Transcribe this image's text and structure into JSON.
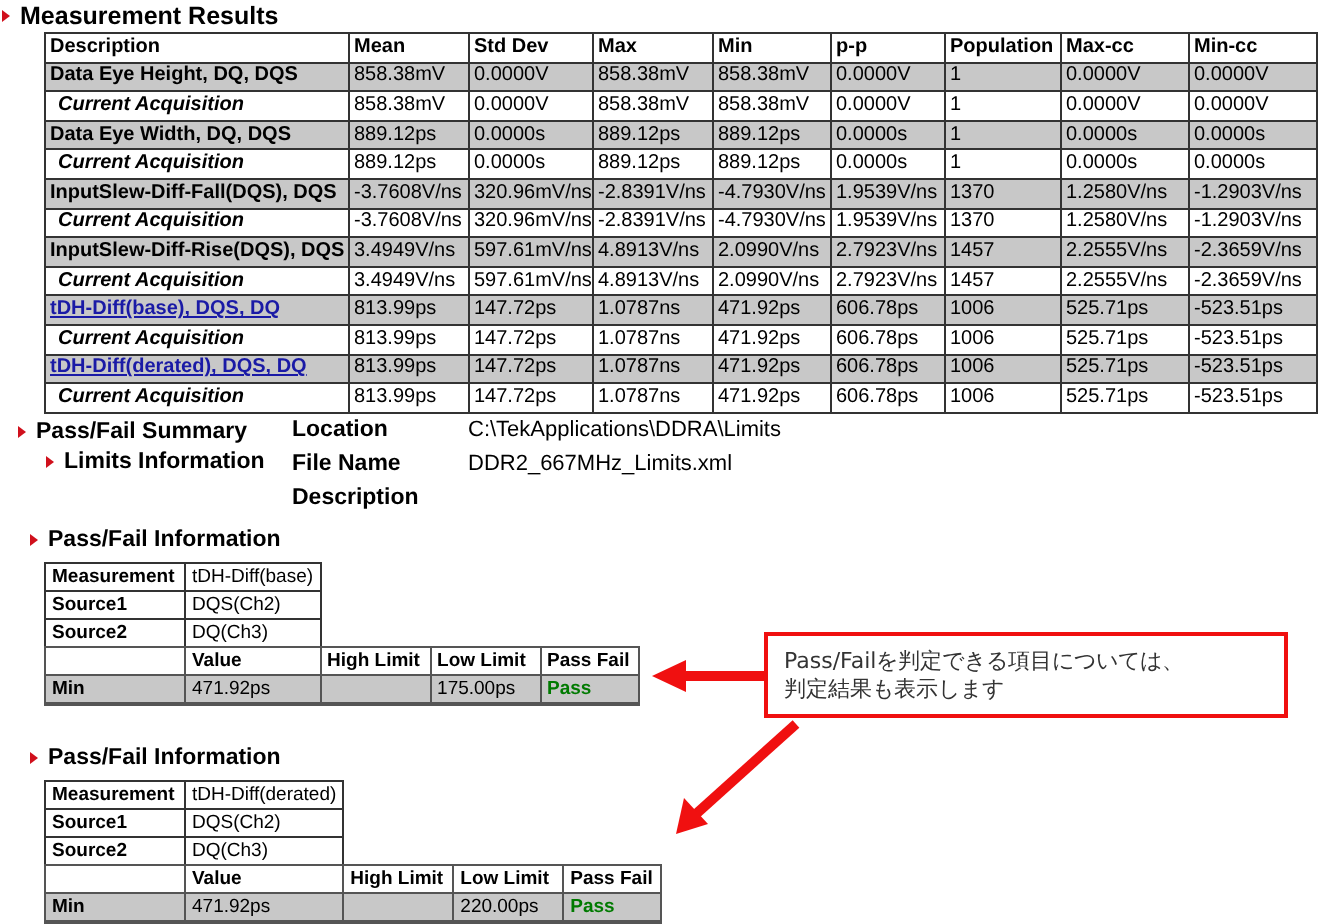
{
  "title": "Measurement Results",
  "results": {
    "columns": [
      "Description",
      "Mean",
      "Std Dev",
      "Max",
      "Min",
      "p-p",
      "Population",
      "Max-cc",
      "Min-cc"
    ],
    "rows": [
      {
        "kind": "measurement",
        "link": false,
        "cells": [
          "Data Eye Height, DQ, DQS",
          "858.38mV",
          "0.0000V",
          "858.38mV",
          "858.38mV",
          "0.0000V",
          "1",
          "0.0000V",
          "0.0000V"
        ]
      },
      {
        "kind": "current",
        "link": false,
        "cells": [
          "Current Acquisition",
          "858.38mV",
          "0.0000V",
          "858.38mV",
          "858.38mV",
          "0.0000V",
          "1",
          "0.0000V",
          "0.0000V"
        ]
      },
      {
        "kind": "measurement",
        "link": false,
        "cells": [
          "Data Eye Width, DQ, DQS",
          "889.12ps",
          "0.0000s",
          "889.12ps",
          "889.12ps",
          "0.0000s",
          "1",
          "0.0000s",
          "0.0000s"
        ]
      },
      {
        "kind": "current",
        "link": false,
        "cells": [
          "Current Acquisition",
          "889.12ps",
          "0.0000s",
          "889.12ps",
          "889.12ps",
          "0.0000s",
          "1",
          "0.0000s",
          "0.0000s"
        ]
      },
      {
        "kind": "measurement",
        "link": false,
        "cells": [
          "InputSlew-Diff-Fall(DQS), DQS",
          "-3.7608V/ns",
          "320.96mV/ns",
          "-2.8391V/ns",
          "-4.7930V/ns",
          "1.9539V/ns",
          "1370",
          "1.2580V/ns",
          "-1.2903V/ns"
        ]
      },
      {
        "kind": "current",
        "link": false,
        "cells": [
          "Current Acquisition",
          "-3.7608V/ns",
          "320.96mV/ns",
          "-2.8391V/ns",
          "-4.7930V/ns",
          "1.9539V/ns",
          "1370",
          "1.2580V/ns",
          "-1.2903V/ns"
        ]
      },
      {
        "kind": "measurement",
        "link": false,
        "cells": [
          "InputSlew-Diff-Rise(DQS), DQS",
          "3.4949V/ns",
          "597.61mV/ns",
          "4.8913V/ns",
          "2.0990V/ns",
          "2.7923V/ns",
          "1457",
          "2.2555V/ns",
          "-2.3659V/ns"
        ]
      },
      {
        "kind": "current",
        "link": false,
        "cells": [
          "Current Acquisition",
          "3.4949V/ns",
          "597.61mV/ns",
          "4.8913V/ns",
          "2.0990V/ns",
          "2.7923V/ns",
          "1457",
          "2.2555V/ns",
          "-2.3659V/ns"
        ]
      },
      {
        "kind": "measurement",
        "link": true,
        "cells": [
          "tDH-Diff(base), DQS, DQ",
          "813.99ps",
          "147.72ps",
          "1.0787ns",
          "471.92ps",
          "606.78ps",
          "1006",
          "525.71ps",
          "-523.51ps"
        ]
      },
      {
        "kind": "current",
        "link": false,
        "cells": [
          "Current Acquisition",
          "813.99ps",
          "147.72ps",
          "1.0787ns",
          "471.92ps",
          "606.78ps",
          "1006",
          "525.71ps",
          "-523.51ps"
        ]
      },
      {
        "kind": "measurement",
        "link": true,
        "cells": [
          "tDH-Diff(derated), DQS, DQ",
          "813.99ps",
          "147.72ps",
          "1.0787ns",
          "471.92ps",
          "606.78ps",
          "1006",
          "525.71ps",
          "-523.51ps"
        ]
      },
      {
        "kind": "current",
        "link": false,
        "cells": [
          "Current Acquisition",
          "813.99ps",
          "147.72ps",
          "1.0787ns",
          "471.92ps",
          "606.78ps",
          "1006",
          "525.71ps",
          "-523.51ps"
        ]
      }
    ]
  },
  "summary": {
    "title": "Pass/Fail Summary",
    "subtitle": "Limits Information",
    "fields": [
      {
        "label": "Location",
        "value": "C:\\TekApplications\\DDRA\\Limits"
      },
      {
        "label": "File Name",
        "value": "DDR2_667MHz_Limits.xml"
      },
      {
        "label": "Description"
      }
    ]
  },
  "pass_fail": [
    {
      "title": "Pass/Fail Information",
      "measurement_label": "Measurement",
      "measurement": "tDH-Diff(base)",
      "sources": [
        {
          "label": "Source1",
          "value": "DQS(Ch2)"
        },
        {
          "label": "Source2",
          "value": "DQ(Ch3)"
        }
      ],
      "columns": [
        "Value",
        "High Limit",
        "Low Limit",
        "Pass Fail"
      ],
      "row": {
        "label": "Min",
        "value": "471.92ps",
        "low": "175.00ps",
        "result": "Pass",
        "passed": true
      }
    },
    {
      "title": "Pass/Fail Information",
      "measurement_label": "Measurement",
      "measurement": "tDH-Diff(derated)",
      "sources": [
        {
          "label": "Source1",
          "value": "DQS(Ch2)"
        },
        {
          "label": "Source2",
          "value": "DQ(Ch3)"
        }
      ],
      "columns": [
        "Value",
        "High Limit",
        "Low Limit",
        "Pass Fail"
      ],
      "row": {
        "label": "Min",
        "value": "471.92ps",
        "low": "220.00ps",
        "result": "Pass",
        "passed": true
      }
    }
  ],
  "callout": {
    "lines": [
      "Pass/Failを判定できる項目については、",
      "判定結果も表示します"
    ]
  }
}
